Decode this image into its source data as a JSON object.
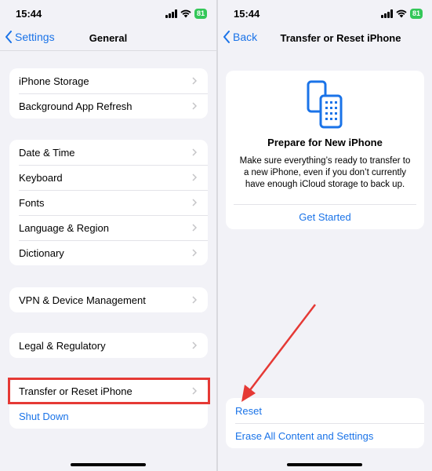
{
  "left": {
    "status": {
      "time": "15:44",
      "battery": "81"
    },
    "nav": {
      "back_label": "Settings",
      "title": "General"
    },
    "groups": [
      [
        "iPhone Storage",
        "Background App Refresh"
      ],
      [
        "Date & Time",
        "Keyboard",
        "Fonts",
        "Language & Region",
        "Dictionary"
      ],
      [
        "VPN & Device Management"
      ],
      [
        "Legal & Regulatory"
      ]
    ],
    "last_group": {
      "transfer": "Transfer or Reset iPhone",
      "shutdown": "Shut Down"
    }
  },
  "right": {
    "status": {
      "time": "15:44",
      "battery": "81"
    },
    "nav": {
      "back_label": "Back",
      "title": "Transfer or Reset iPhone"
    },
    "card": {
      "title": "Prepare for New iPhone",
      "description": "Make sure everything’s ready to transfer to a new iPhone, even if you don’t currently have enough iCloud storage to back up.",
      "button": "Get Started"
    },
    "bottom": {
      "reset": "Reset",
      "erase": "Erase All Content and Settings"
    }
  },
  "colors": {
    "accent": "#1a73e8",
    "highlight": "#e53935",
    "battery": "#34c759"
  }
}
